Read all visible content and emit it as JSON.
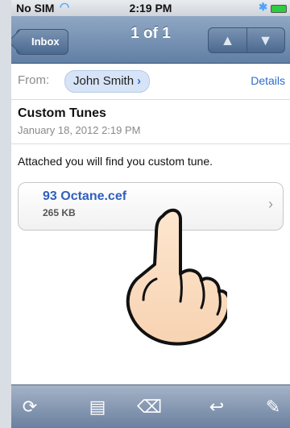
{
  "status_bar": {
    "carrier": "No SIM",
    "time": "2:19 PM"
  },
  "nav": {
    "back_label": "Inbox",
    "title": "1 of 1",
    "up_icon": "▲",
    "down_icon": "▼"
  },
  "from": {
    "label": "From:",
    "name": "John Smith",
    "chevron": "›",
    "details": "Details"
  },
  "message": {
    "subject": "Custom Tunes",
    "date": "January 18, 2012 2:19 PM",
    "body": "Attached you will find you custom tune."
  },
  "attachment": {
    "name": "93 Octane.cef",
    "size": "265 KB",
    "chevron": "›"
  },
  "toolbar": {
    "icons": [
      "refresh-icon",
      "move-to-folder-icon",
      "delete-icon",
      "reply-icon",
      "compose-icon"
    ]
  },
  "colors": {
    "nav_top": "#8fa7c3",
    "nav_bottom": "#617fa4",
    "link": "#2e6ccf",
    "attachment_name": "#2f5fbf"
  }
}
